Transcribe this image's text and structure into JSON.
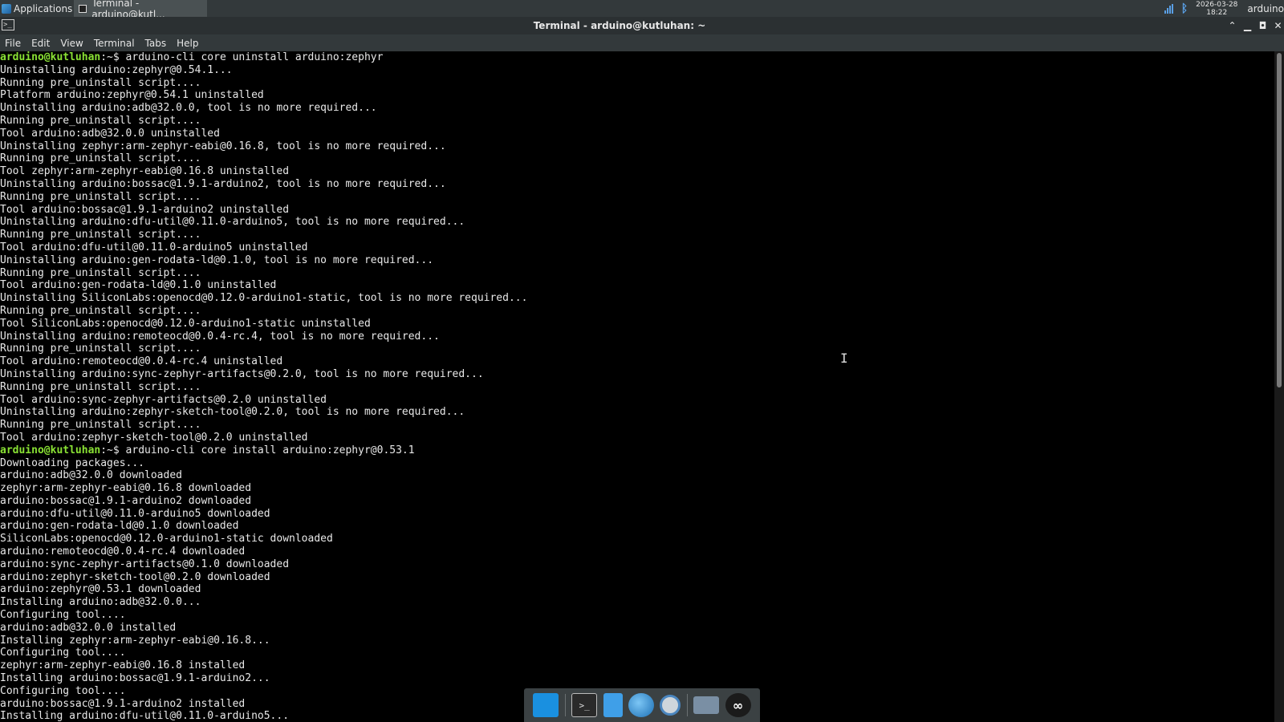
{
  "panel": {
    "applications_label": "Applications",
    "task_label": "Terminal - arduino@kutl...",
    "clock_date": "2026-03-28",
    "clock_time": "18:22",
    "user": "arduino"
  },
  "window": {
    "title": "Terminal - arduino@kutluhan: ~"
  },
  "menu": {
    "items": [
      "File",
      "Edit",
      "View",
      "Terminal",
      "Tabs",
      "Help"
    ]
  },
  "terminal": {
    "prompt": "arduino@kutluhan",
    "prompt_suffix": ":~$ ",
    "lines": [
      {
        "prompt": true,
        "text": "arduino-cli core uninstall arduino:zephyr"
      },
      {
        "text": "Uninstalling arduino:zephyr@0.54.1..."
      },
      {
        "text": "Running pre_uninstall script...."
      },
      {
        "text": "Platform arduino:zephyr@0.54.1 uninstalled"
      },
      {
        "text": "Uninstalling arduino:adb@32.0.0, tool is no more required..."
      },
      {
        "text": "Running pre_uninstall script...."
      },
      {
        "text": "Tool arduino:adb@32.0.0 uninstalled"
      },
      {
        "text": "Uninstalling zephyr:arm-zephyr-eabi@0.16.8, tool is no more required..."
      },
      {
        "text": "Running pre_uninstall script...."
      },
      {
        "text": "Tool zephyr:arm-zephyr-eabi@0.16.8 uninstalled"
      },
      {
        "text": "Uninstalling arduino:bossac@1.9.1-arduino2, tool is no more required..."
      },
      {
        "text": "Running pre_uninstall script...."
      },
      {
        "text": "Tool arduino:bossac@1.9.1-arduino2 uninstalled"
      },
      {
        "text": "Uninstalling arduino:dfu-util@0.11.0-arduino5, tool is no more required..."
      },
      {
        "text": "Running pre_uninstall script...."
      },
      {
        "text": "Tool arduino:dfu-util@0.11.0-arduino5 uninstalled"
      },
      {
        "text": "Uninstalling arduino:gen-rodata-ld@0.1.0, tool is no more required..."
      },
      {
        "text": "Running pre_uninstall script...."
      },
      {
        "text": "Tool arduino:gen-rodata-ld@0.1.0 uninstalled"
      },
      {
        "text": "Uninstalling SiliconLabs:openocd@0.12.0-arduino1-static, tool is no more required..."
      },
      {
        "text": "Running pre_uninstall script...."
      },
      {
        "text": "Tool SiliconLabs:openocd@0.12.0-arduino1-static uninstalled"
      },
      {
        "text": "Uninstalling arduino:remoteocd@0.0.4-rc.4, tool is no more required..."
      },
      {
        "text": "Running pre_uninstall script...."
      },
      {
        "text": "Tool arduino:remoteocd@0.0.4-rc.4 uninstalled"
      },
      {
        "text": "Uninstalling arduino:sync-zephyr-artifacts@0.2.0, tool is no more required..."
      },
      {
        "text": "Running pre_uninstall script...."
      },
      {
        "text": "Tool arduino:sync-zephyr-artifacts@0.2.0 uninstalled"
      },
      {
        "text": "Uninstalling arduino:zephyr-sketch-tool@0.2.0, tool is no more required..."
      },
      {
        "text": "Running pre_uninstall script...."
      },
      {
        "text": "Tool arduino:zephyr-sketch-tool@0.2.0 uninstalled"
      },
      {
        "prompt": true,
        "text": "arduino-cli core install arduino:zephyr@0.53.1"
      },
      {
        "text": "Downloading packages..."
      },
      {
        "text": "arduino:adb@32.0.0 downloaded"
      },
      {
        "text": "zephyr:arm-zephyr-eabi@0.16.8 downloaded"
      },
      {
        "text": "arduino:bossac@1.9.1-arduino2 downloaded"
      },
      {
        "text": "arduino:dfu-util@0.11.0-arduino5 downloaded"
      },
      {
        "text": "arduino:gen-rodata-ld@0.1.0 downloaded"
      },
      {
        "text": "SiliconLabs:openocd@0.12.0-arduino1-static downloaded"
      },
      {
        "text": "arduino:remoteocd@0.0.4-rc.4 downloaded"
      },
      {
        "text": "arduino:sync-zephyr-artifacts@0.1.0 downloaded"
      },
      {
        "text": "arduino:zephyr-sketch-tool@0.2.0 downloaded"
      },
      {
        "text": "arduino:zephyr@0.53.1 downloaded"
      },
      {
        "text": "Installing arduino:adb@32.0.0..."
      },
      {
        "text": "Configuring tool...."
      },
      {
        "text": "arduino:adb@32.0.0 installed"
      },
      {
        "text": "Installing zephyr:arm-zephyr-eabi@0.16.8..."
      },
      {
        "text": "Configuring tool...."
      },
      {
        "text": "zephyr:arm-zephyr-eabi@0.16.8 installed"
      },
      {
        "text": "Installing arduino:bossac@1.9.1-arduino2..."
      },
      {
        "text": "Configuring tool...."
      },
      {
        "text": "arduino:bossac@1.9.1-arduino2 installed"
      },
      {
        "text": "Installing arduino:dfu-util@0.11.0-arduino5..."
      }
    ]
  },
  "dock": {
    "items": [
      "desktop-icon",
      "terminal-icon",
      "text-editor-icon",
      "web-browser-icon",
      "app-finder-icon",
      "file-manager-icon",
      "arduino-icon"
    ]
  },
  "colors": {
    "prompt": "#8ae234",
    "terminal_bg": "#000000",
    "terminal_fg": "#e8e8e8"
  }
}
